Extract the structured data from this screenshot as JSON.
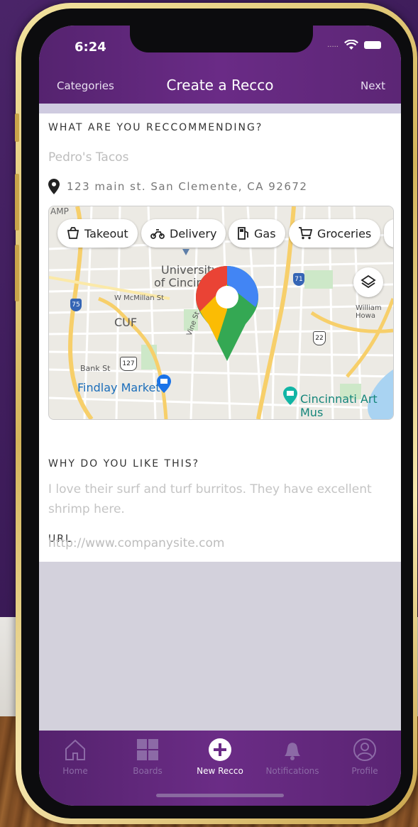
{
  "status_bar": {
    "time": "6:24",
    "signal": "....."
  },
  "nav": {
    "left": "Categories",
    "title": "Create a Recco",
    "right": "Next"
  },
  "form": {
    "recommending_label": "WHAT ARE YOU RECCOMMENDING?",
    "recommending_value": "Pedro's Tacos",
    "address": "123 main st. San Clemente, CA 92672",
    "why_label": "WHY DO YOU LIKE THIS?",
    "why_placeholder": "I love their surf and turf burritos. They have excellent shrimp here.",
    "url_label": "URL",
    "url_placeholder": "http://www.companysite.com"
  },
  "map": {
    "chips": [
      {
        "label": "Takeout",
        "icon": "takeout-icon"
      },
      {
        "label": "Delivery",
        "icon": "delivery-icon"
      },
      {
        "label": "Gas",
        "icon": "gas-icon"
      },
      {
        "label": "Groceries",
        "icon": "groceries-icon"
      }
    ],
    "labels": {
      "amp": "AMP",
      "university_line1": "University",
      "university_line2": "of Cincin",
      "mcmillan": "W McMillan St",
      "cuf": "CUF",
      "bank": "Bank St",
      "findlay": "Findlay Market",
      "art": "Cincinnati Art Mus",
      "william": "William Howa",
      "vine": "Vine St",
      "r71": "71",
      "r75": "75",
      "r22": "22",
      "r127": "127"
    }
  },
  "tabs": [
    {
      "label": "Home",
      "icon": "home-icon",
      "active": false
    },
    {
      "label": "Boards",
      "icon": "boards-icon",
      "active": false
    },
    {
      "label": "New Recco",
      "icon": "add-circle-icon",
      "active": true
    },
    {
      "label": "Notifications",
      "icon": "bell-icon",
      "active": false
    },
    {
      "label": "Profile",
      "icon": "profile-icon",
      "active": false
    }
  ],
  "colors": {
    "header": "#6a2b86",
    "active_tab": "#ffffff",
    "inactive_tab": "#8c6aa6"
  }
}
